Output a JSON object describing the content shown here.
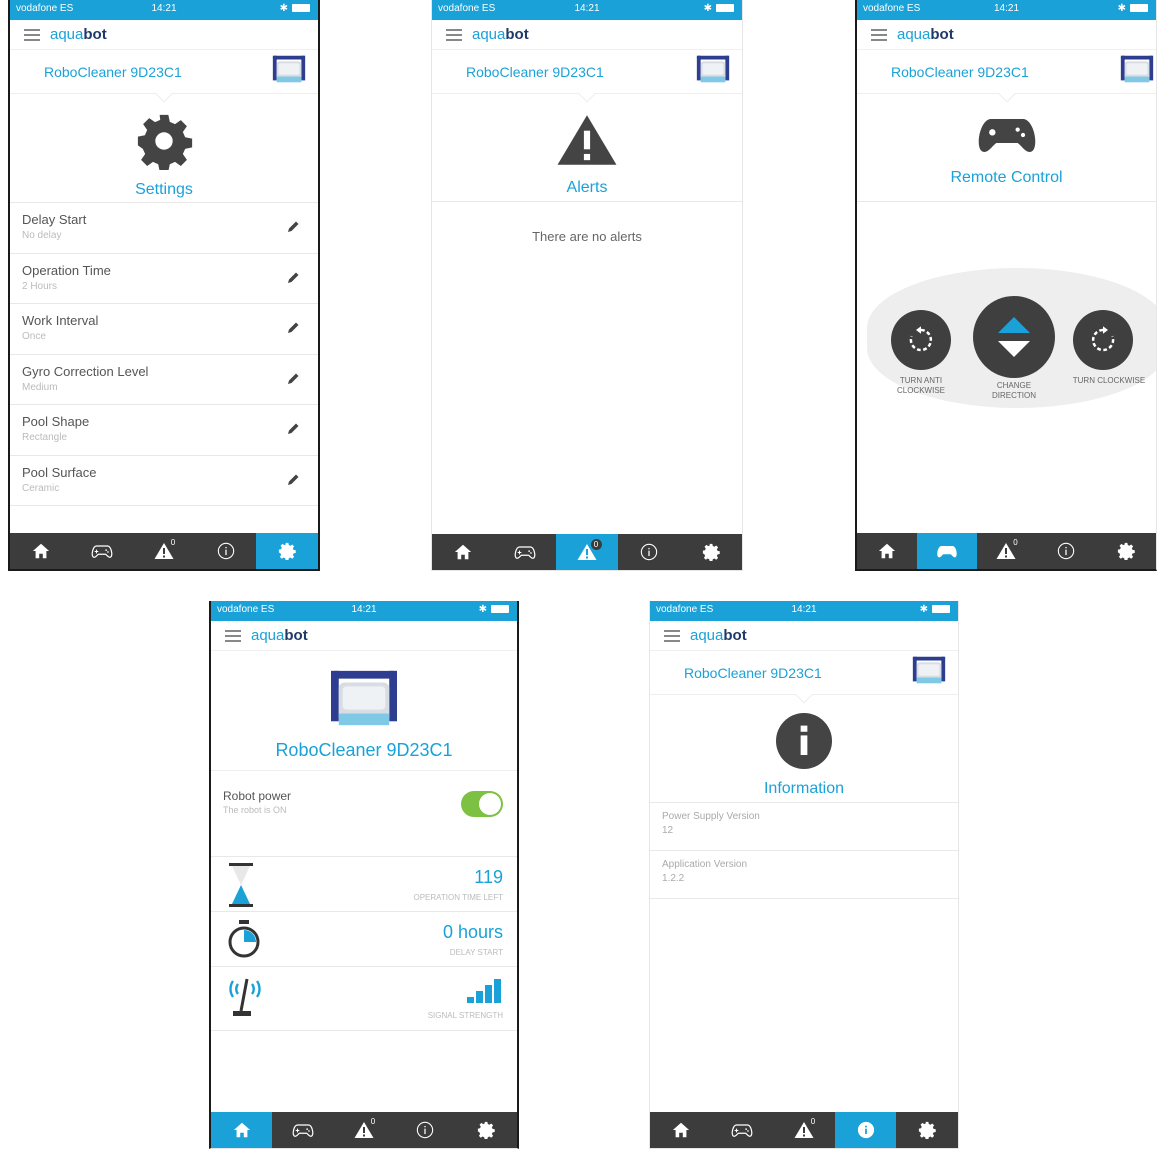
{
  "status": {
    "carrier": "vodafone ES",
    "time": "14:21"
  },
  "logo": {
    "part1": "aqua",
    "part2": "bot"
  },
  "device_name": "RoboCleaner 9D23C1",
  "colors": {
    "accent": "#1aa2d8",
    "dark": "#3c3c3c",
    "toggle": "#7cc142"
  },
  "nav": {
    "alerts_badge": "0",
    "icons": [
      "home-icon",
      "gamepad-icon",
      "alert-icon",
      "info-icon",
      "gear-icon"
    ]
  },
  "settings": {
    "title": "Settings",
    "items": [
      {
        "label": "Delay Start",
        "value": "No delay"
      },
      {
        "label": "Operation Time",
        "value": "2 Hours"
      },
      {
        "label": "Work Interval",
        "value": "Once"
      },
      {
        "label": "Gyro Correction Level",
        "value": "Medium"
      },
      {
        "label": "Pool Shape",
        "value": "Rectangle"
      },
      {
        "label": "Pool Surface",
        "value": "Ceramic"
      }
    ]
  },
  "alerts": {
    "title": "Alerts",
    "empty": "There are no alerts"
  },
  "remote": {
    "title": "Remote Control",
    "turn_anti_1": "TURN ANTI",
    "turn_anti_2": "CLOCKWISE",
    "change_1": "CHANGE",
    "change_2": "DIRECTION",
    "turn_cw": "TURN CLOCKWISE"
  },
  "home": {
    "power_label": "Robot power",
    "power_status": "The robot is ON",
    "power_on": true,
    "operation_value": "119",
    "operation_caption": "OPERATION TIME LEFT",
    "delay_value": "0 hours",
    "delay_caption": "DELAY START",
    "signal_caption": "SIGNAL STRENGTH",
    "signal_level": 4
  },
  "info": {
    "title": "Information",
    "items": [
      {
        "label": "Power Supply Version",
        "value": "12"
      },
      {
        "label": "Application Version",
        "value": "1.2.2"
      }
    ]
  }
}
